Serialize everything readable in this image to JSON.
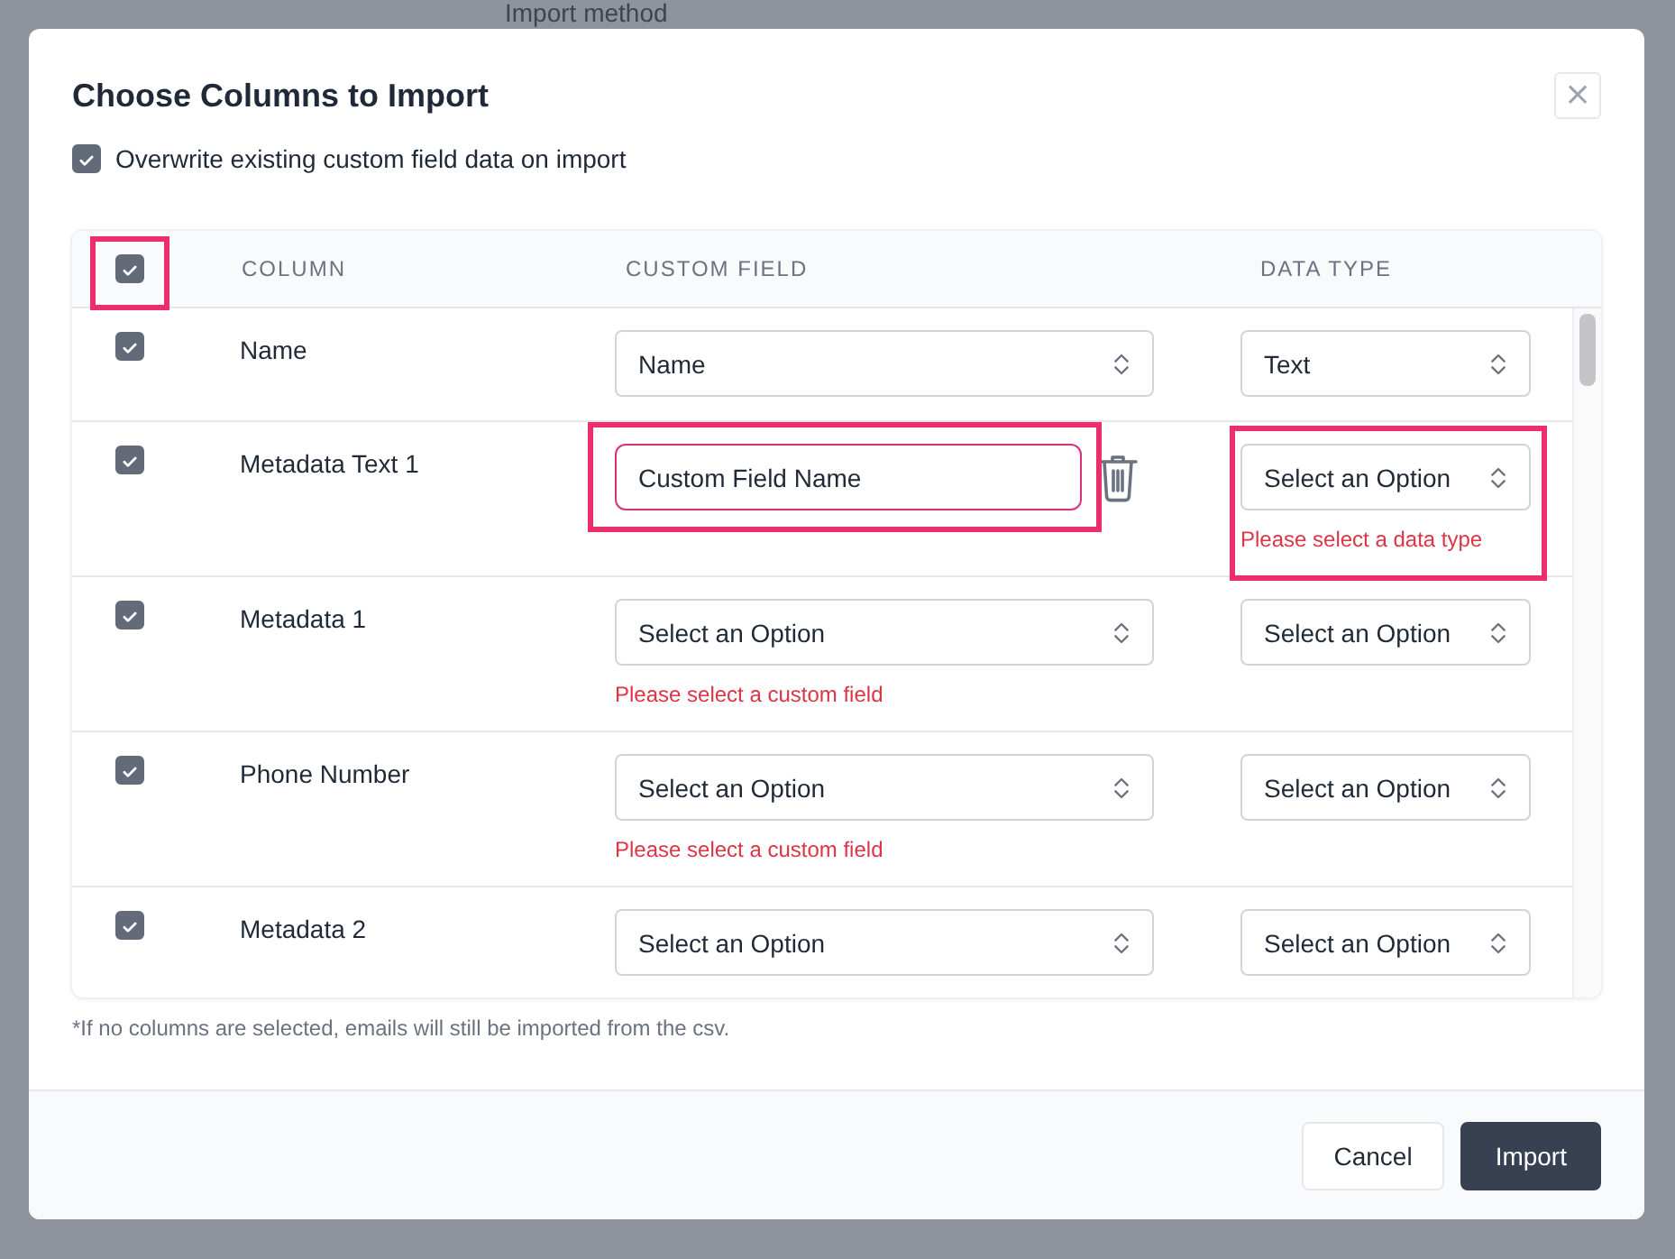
{
  "background": {
    "heading": "Import method"
  },
  "dialog": {
    "title": "Choose Columns to Import",
    "close_label": "×",
    "overwrite": {
      "label": "Overwrite existing custom field data on import",
      "checked": true
    }
  },
  "table": {
    "select_all": {
      "checked": true,
      "highlighted": true
    },
    "columns": [
      "COLUMN",
      "CUSTOM FIELD",
      "DATA TYPE"
    ],
    "rows": [
      {
        "column": "Name",
        "checked": true,
        "custom_field": {
          "kind": "select",
          "value": "Name",
          "deletable": false,
          "highlighted": false
        },
        "data_type": {
          "value": "Text",
          "highlighted": false
        }
      },
      {
        "column": "Metadata Text 1",
        "checked": true,
        "custom_field": {
          "kind": "input",
          "value": "Custom Field Name",
          "deletable": true,
          "highlighted": true
        },
        "data_type": {
          "value": "Select an Option",
          "error": "Please select a data type",
          "highlighted": true
        }
      },
      {
        "column": "Metadata 1",
        "checked": true,
        "custom_field": {
          "kind": "select",
          "value": "Select an Option",
          "error": "Please select a custom field",
          "deletable": false,
          "highlighted": false
        },
        "data_type": {
          "value": "Select an Option",
          "highlighted": false
        }
      },
      {
        "column": "Phone Number",
        "checked": true,
        "custom_field": {
          "kind": "select",
          "value": "Select an Option",
          "error": "Please select a custom field",
          "deletable": false,
          "highlighted": false
        },
        "data_type": {
          "value": "Select an Option",
          "highlighted": false
        }
      },
      {
        "column": "Metadata 2",
        "checked": true,
        "custom_field": {
          "kind": "select",
          "value": "Select an Option",
          "deletable": false,
          "highlighted": false
        },
        "data_type": {
          "value": "Select an Option",
          "highlighted": false
        }
      }
    ]
  },
  "note": "*If no columns are selected, emails will still be imported from the csv.",
  "buttons": [
    {
      "label": "Cancel",
      "kind": "secondary"
    },
    {
      "label": "Import",
      "kind": "primary"
    }
  ]
}
